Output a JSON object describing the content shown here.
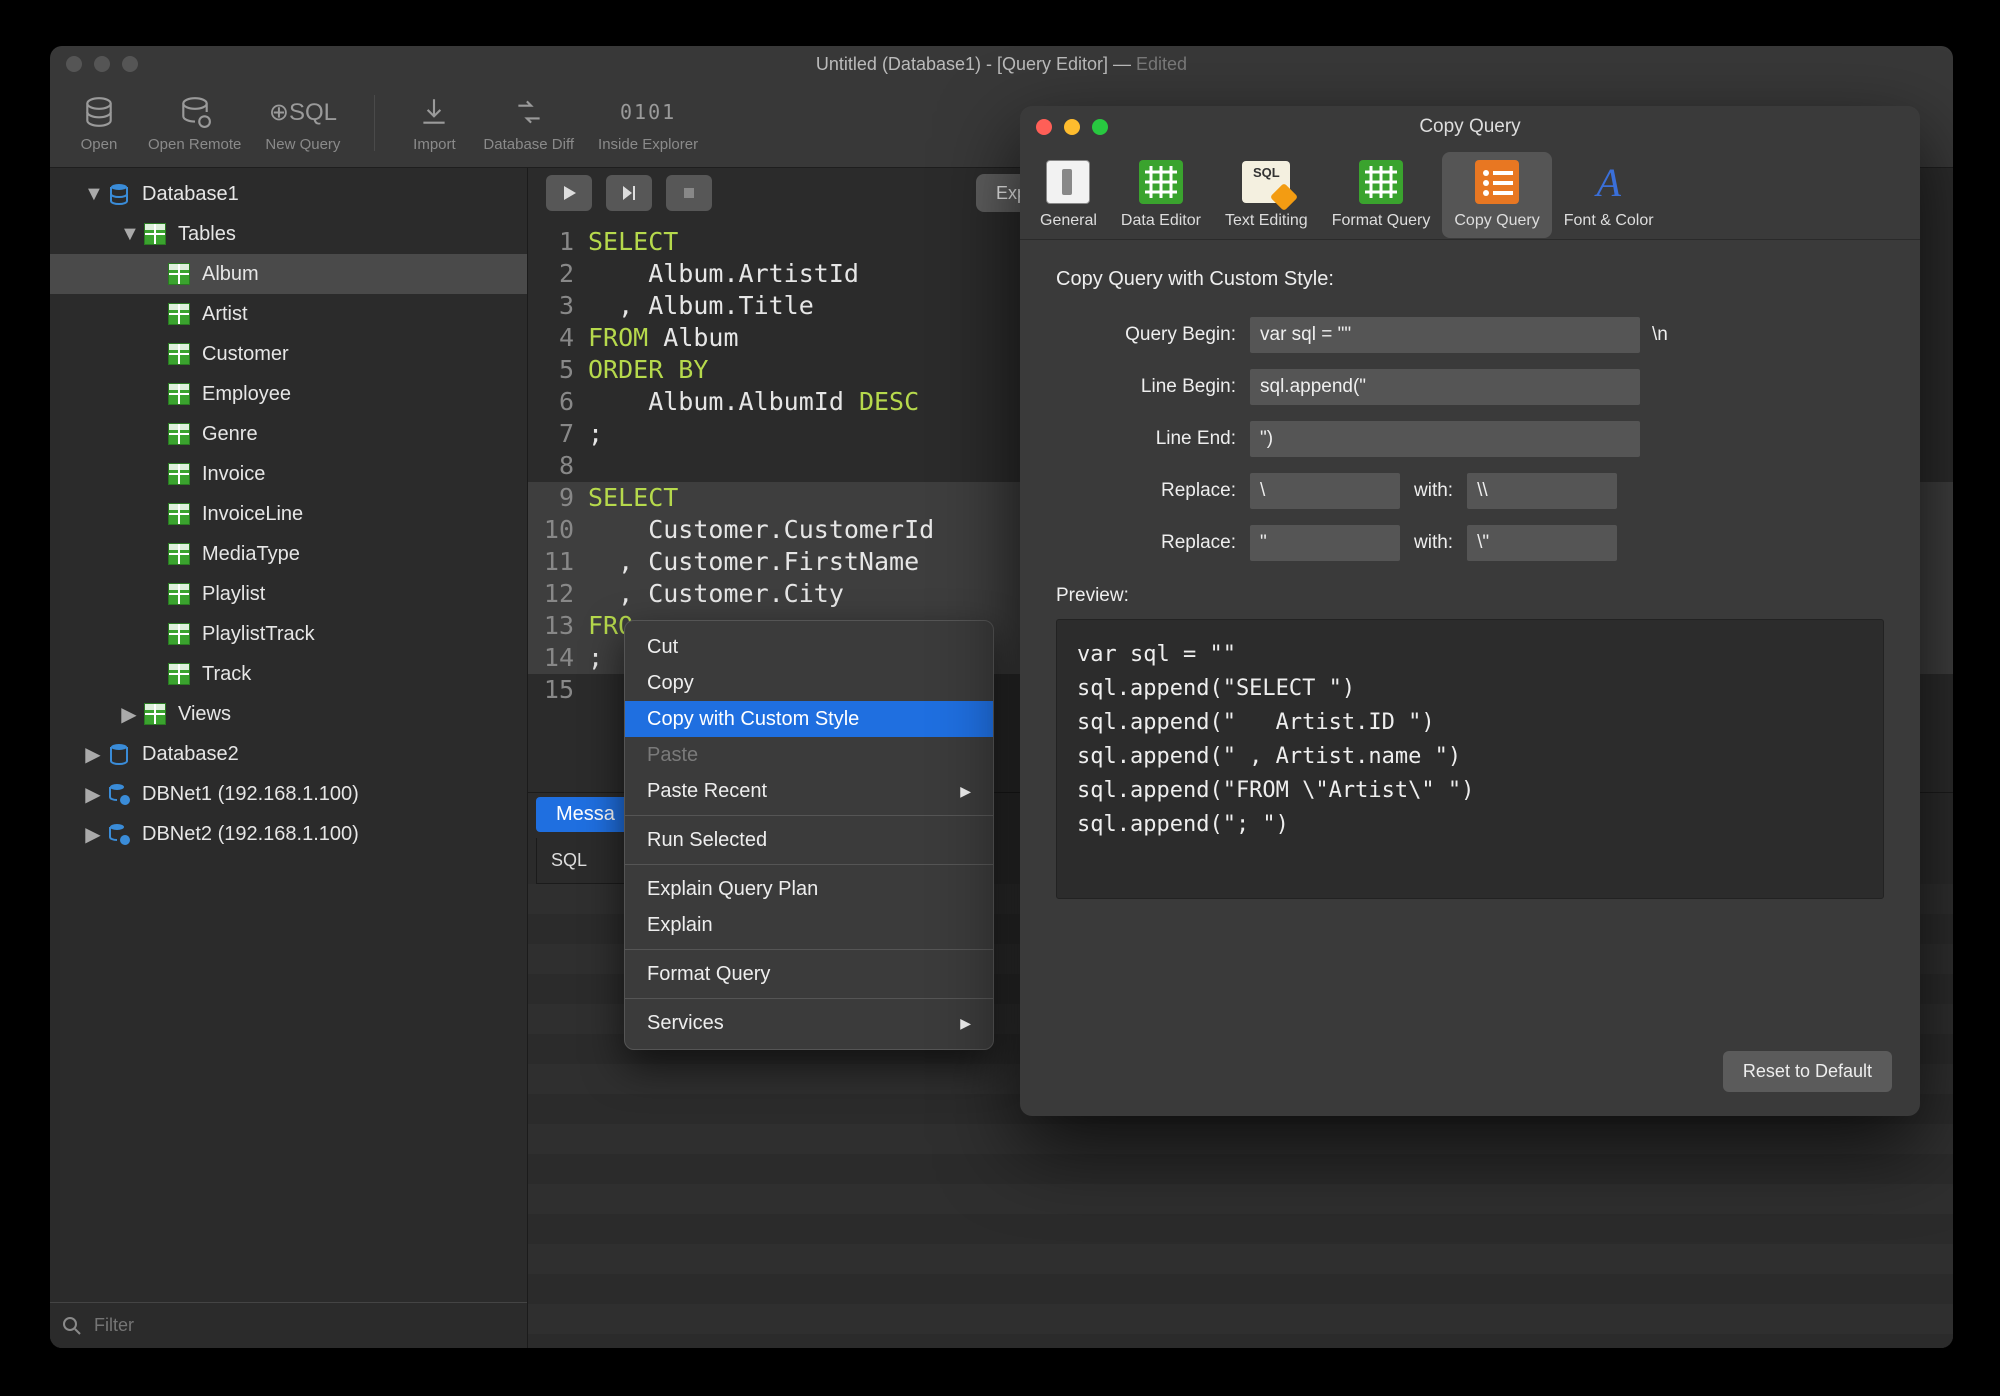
{
  "window": {
    "title_prefix": "Untitled (Database1) - [Query Editor] — ",
    "title_suffix": "Edited"
  },
  "toolbar": {
    "open": "Open",
    "open_remote": "Open Remote",
    "new_query": "New Query",
    "import": "Import",
    "database_diff": "Database Diff",
    "inside_explorer": "Inside Explorer",
    "inside_code": "0101"
  },
  "sidebar": {
    "db1": "Database1",
    "tables": "Tables",
    "items": [
      "Album",
      "Artist",
      "Customer",
      "Employee",
      "Genre",
      "Invoice",
      "InvoiceLine",
      "MediaType",
      "Playlist",
      "PlaylistTrack",
      "Track"
    ],
    "views": "Views",
    "db2": "Database2",
    "net1": "DBNet1 (192.168.1.100)",
    "net2": "DBNet2 (192.168.1.100)",
    "filter_placeholder": "Filter"
  },
  "editor": {
    "explain_btn": "Explain Quer",
    "lines": [
      {
        "n": "1",
        "seg": [
          [
            "kw",
            "SELECT"
          ]
        ]
      },
      {
        "n": "2",
        "seg": [
          [
            "tx",
            "    Album.ArtistId"
          ]
        ]
      },
      {
        "n": "3",
        "seg": [
          [
            "tx",
            "  , Album.Title"
          ]
        ]
      },
      {
        "n": "4",
        "seg": [
          [
            "kw",
            "FROM"
          ],
          [
            "tx",
            " Album"
          ]
        ]
      },
      {
        "n": "5",
        "seg": [
          [
            "kw",
            "ORDER BY"
          ]
        ]
      },
      {
        "n": "6",
        "seg": [
          [
            "tx",
            "    Album.AlbumId "
          ],
          [
            "kw",
            "DESC"
          ]
        ]
      },
      {
        "n": "7",
        "seg": [
          [
            "tx",
            ";"
          ]
        ]
      },
      {
        "n": "8",
        "seg": [
          [
            "tx",
            ""
          ]
        ]
      },
      {
        "n": "9",
        "seg": [
          [
            "kw",
            "SELECT"
          ]
        ],
        "hl": true
      },
      {
        "n": "10",
        "seg": [
          [
            "tx",
            "    Customer.CustomerId"
          ]
        ],
        "hl": true
      },
      {
        "n": "11",
        "seg": [
          [
            "tx",
            "  , Customer.FirstName"
          ]
        ],
        "hl": true
      },
      {
        "n": "12",
        "seg": [
          [
            "tx",
            "  , Customer.City"
          ]
        ],
        "hl": true
      },
      {
        "n": "13",
        "seg": [
          [
            "kw",
            "FRO"
          ]
        ],
        "hl": true
      },
      {
        "n": "14",
        "seg": [
          [
            "tx",
            ";"
          ]
        ],
        "hl": true
      },
      {
        "n": "15",
        "seg": [
          [
            "tx",
            ""
          ]
        ]
      }
    ]
  },
  "messages": {
    "tab": "Messa",
    "sql_col": "SQL"
  },
  "ctx": {
    "cut": "Cut",
    "copy": "Copy",
    "copy_custom": "Copy with Custom Style",
    "paste": "Paste",
    "paste_recent": "Paste Recent",
    "run_selected": "Run Selected",
    "explain_plan": "Explain Query Plan",
    "explain": "Explain",
    "format_query": "Format Query",
    "services": "Services"
  },
  "pref": {
    "title": "Copy Query",
    "tabs": {
      "general": "General",
      "data_editor": "Data Editor",
      "text_editing": "Text Editing",
      "format_query": "Format Query",
      "copy_query": "Copy Query",
      "font_color": "Font & Color"
    },
    "heading": "Copy Query with Custom Style:",
    "labels": {
      "query_begin": "Query Begin:",
      "line_begin": "Line Begin:",
      "line_end": "Line End:",
      "replace": "Replace:",
      "with": "with:",
      "preview": "Preview:"
    },
    "values": {
      "query_begin": "var sql = \"\"",
      "line_begin": "sql.append(\"",
      "line_end": "\")",
      "rep1_from": "\\",
      "rep1_to": "\\\\",
      "rep2_from": "\"",
      "rep2_to": "\\\"",
      "trail": "\\n"
    },
    "preview": "var sql = \"\"\nsql.append(\"SELECT \")\nsql.append(\"   Artist.ID \")\nsql.append(\" , Artist.name \")\nsql.append(\"FROM \\\"Artist\\\" \")\nsql.append(\"; \")",
    "reset": "Reset to Default"
  }
}
